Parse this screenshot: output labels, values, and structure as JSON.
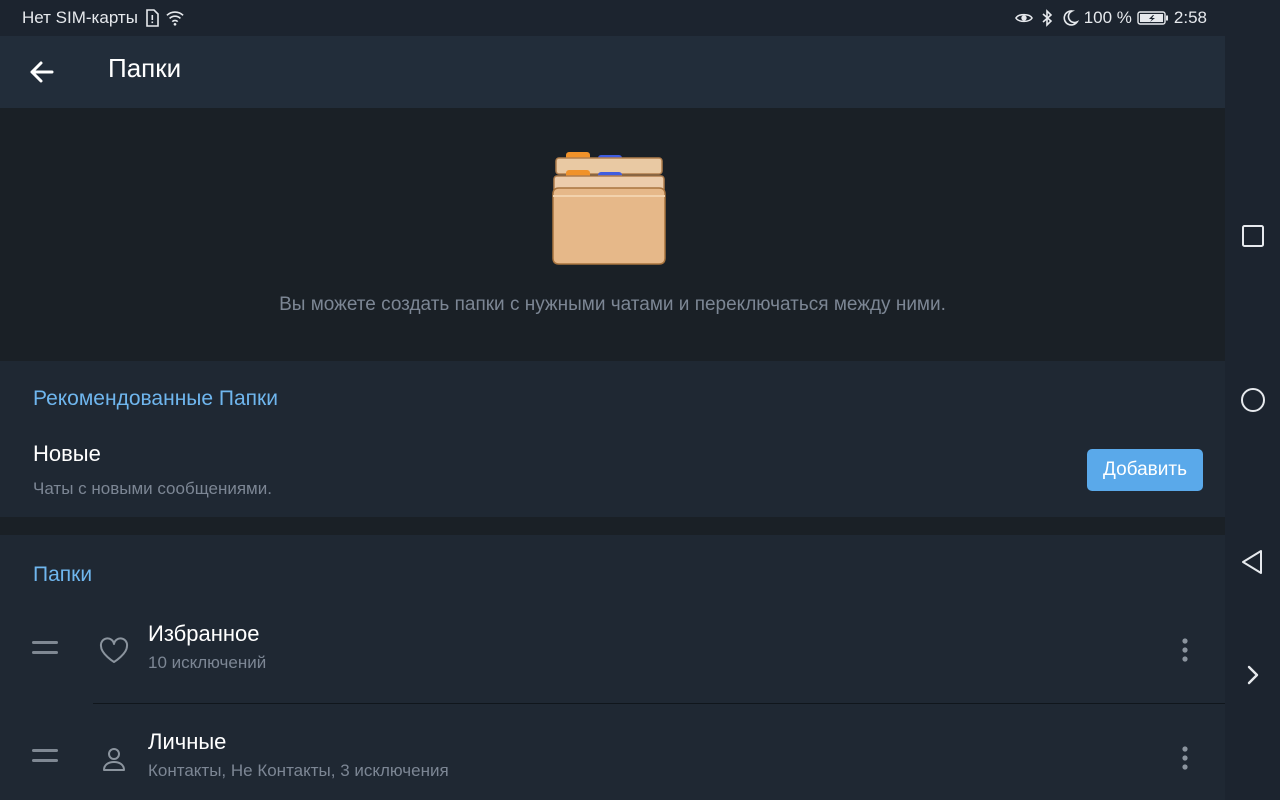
{
  "status_bar": {
    "carrier": "Нет SIM-карты",
    "battery": "100 %",
    "time": "2:58",
    "icons_left": [
      "sim-icon",
      "wifi-icon"
    ],
    "icons_right": [
      "eye-icon",
      "bluetooth-icon",
      "moon-icon",
      "battery-icon"
    ]
  },
  "header": {
    "title": "Папки",
    "back_icon": "arrow-left-icon"
  },
  "hero": {
    "description": "Вы можете создать папки с нужными чатами и переключаться между ними."
  },
  "recommended": {
    "header": "Рекомендованные Папки",
    "item": {
      "title": "Новые",
      "subtitle": "Чаты с новыми сообщениями.",
      "button": "Добавить"
    }
  },
  "folders": {
    "header": "Папки",
    "items": [
      {
        "name": "Избранное",
        "subtitle": "10 исключений",
        "icon": "heart-icon"
      },
      {
        "name": "Личные",
        "subtitle": "Контакты, Не Контакты, 3 исключения",
        "icon": "user-icon"
      }
    ]
  },
  "colors": {
    "accent": "#6fb6ee",
    "button": "#5aa9ea",
    "background": "#1a2026",
    "card": "#1f2833",
    "header": "#222d3a"
  },
  "navbar": {
    "icons": [
      "square-recents-icon",
      "circle-home-icon",
      "triangle-back-icon",
      "chevron-right-icon"
    ]
  }
}
